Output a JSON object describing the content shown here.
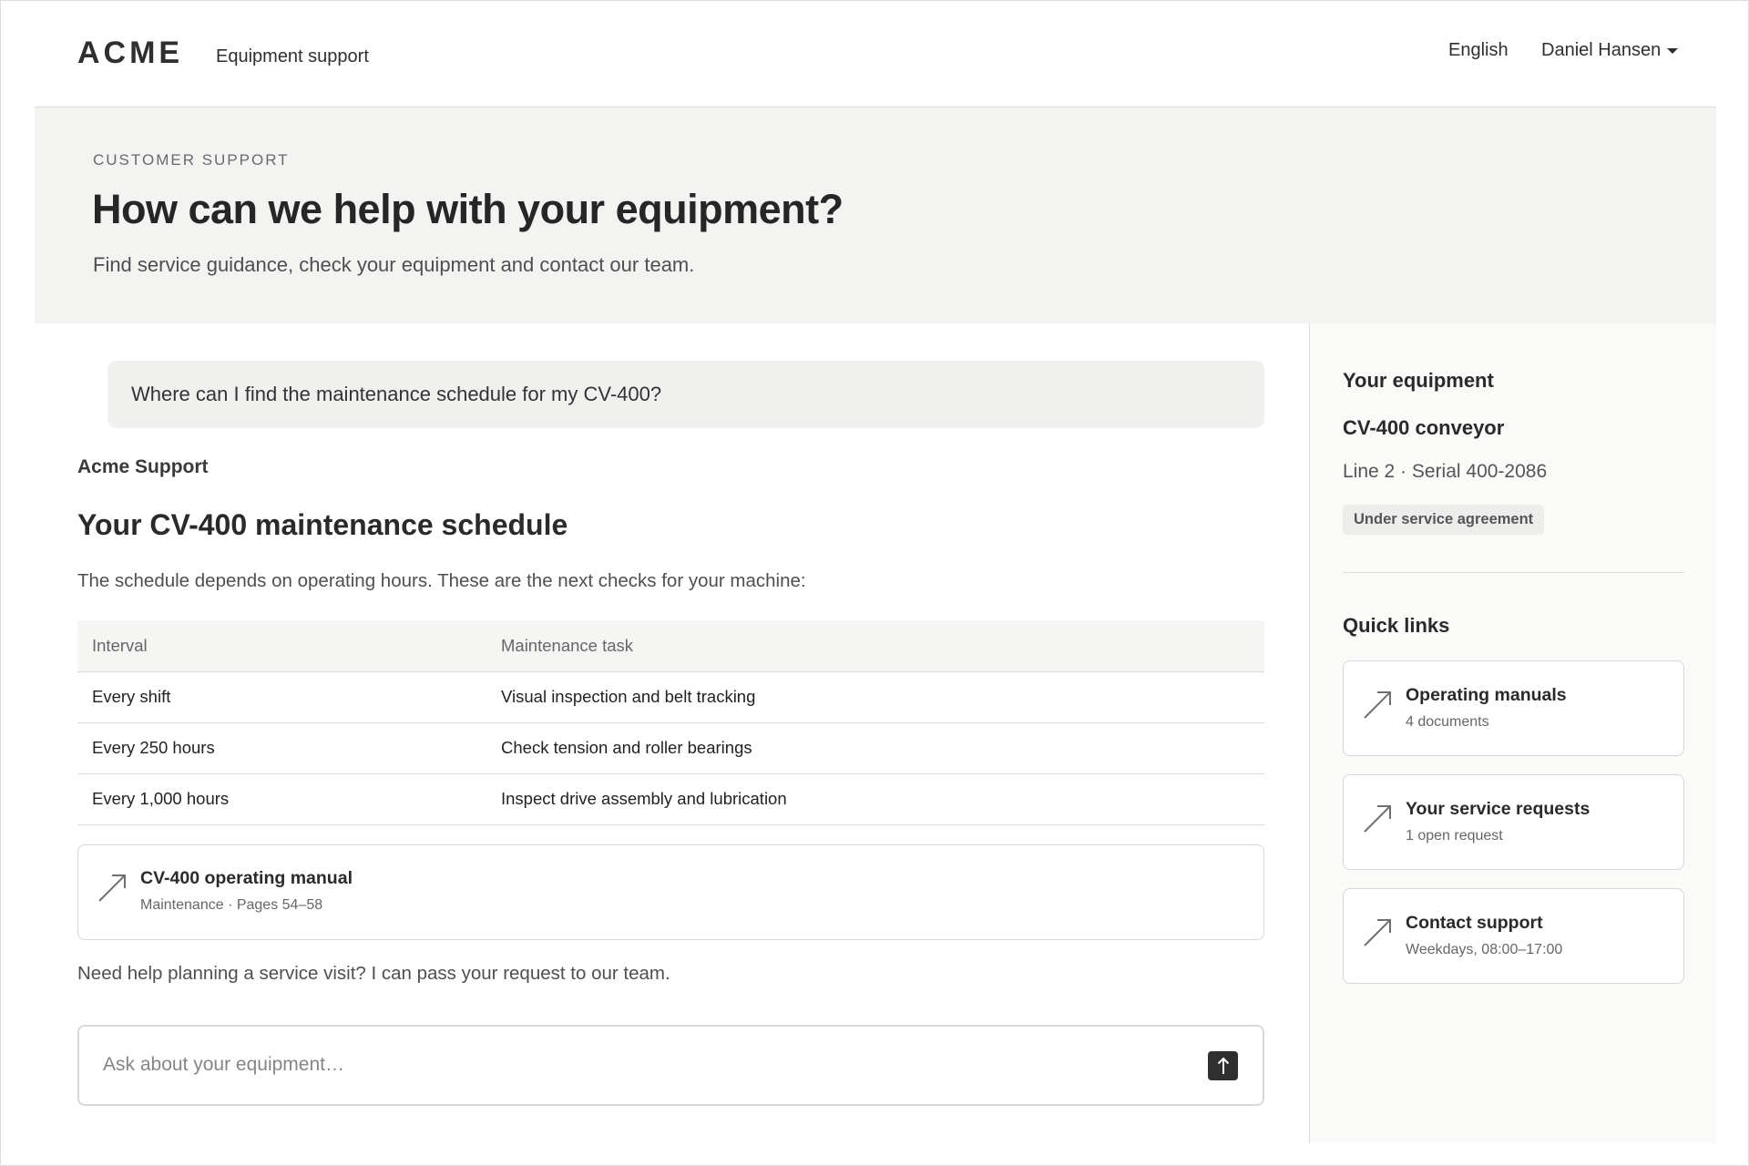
{
  "header": {
    "logo": "ACME",
    "product": "Equipment support",
    "language": "English",
    "user": "Daniel Hansen"
  },
  "hero": {
    "eyebrow": "CUSTOMER SUPPORT",
    "title": "How can we help with your equipment?",
    "subtitle": "Find service guidance, check your equipment and contact our team."
  },
  "chat": {
    "user_message": "Where can I find the maintenance schedule for my CV-400?",
    "assistant_name": "Acme Support",
    "answer_title": "Your CV-400 maintenance schedule",
    "answer_intro": "The schedule depends on operating hours. These are the next checks for your machine:",
    "table": {
      "headers": [
        "Interval",
        "Maintenance task"
      ],
      "rows": [
        [
          "Every shift",
          "Visual inspection and belt tracking"
        ],
        [
          "Every 250 hours",
          "Check tension and roller bearings"
        ],
        [
          "Every 1,000 hours",
          "Inspect drive assembly and lubrication"
        ]
      ]
    },
    "doc_card": {
      "title": "CV-400 operating manual",
      "meta": "Maintenance · Pages 54–58",
      "icon": "arrow-up-right-icon"
    },
    "followup": "Need help planning a service visit? I can pass your request to our team.",
    "composer": {
      "placeholder": "Ask about your equipment…",
      "value": "",
      "send_icon": "arrow-up-icon"
    }
  },
  "sidebar": {
    "equipment_heading": "Your equipment",
    "equipment_name": "CV-400 conveyor",
    "equipment_meta": "Line 2 · Serial 400-2086",
    "status_badge": "Under service agreement",
    "quick_links_heading": "Quick links",
    "quick_links": [
      {
        "title": "Operating manuals",
        "meta": "4 documents",
        "icon": "arrow-up-right-icon"
      },
      {
        "title": "Your service requests",
        "meta": "1 open request",
        "icon": "arrow-up-right-icon"
      },
      {
        "title": "Contact support",
        "meta": "Weekdays, 08:00–17:00",
        "icon": "arrow-up-right-icon"
      }
    ]
  },
  "colors": {
    "hero_bg": "#f3f3f1",
    "sidebar_bg": "#fafaf8",
    "text": "#2a2a2a",
    "send_button": "#2f2f2f"
  }
}
